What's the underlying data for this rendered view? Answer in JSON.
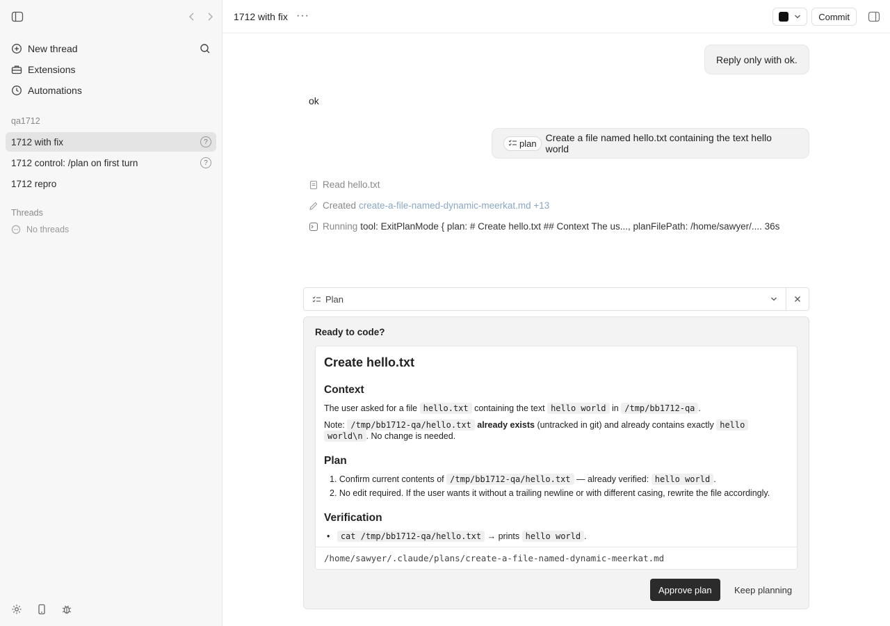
{
  "sidebar": {
    "new_thread": "New thread",
    "extensions": "Extensions",
    "automations": "Automations",
    "project": "qa1712",
    "project_threads": [
      {
        "label": "1712 with fix",
        "active": true,
        "help": "?"
      },
      {
        "label": "1712 control: /plan on first turn",
        "active": false,
        "help": "?"
      },
      {
        "label": "1712 repro",
        "active": false
      }
    ],
    "threads_header": "Threads",
    "no_threads": "No threads"
  },
  "topbar": {
    "title": "1712 with fix",
    "more": "···",
    "commit": "Commit"
  },
  "conversation": {
    "user_msg_1": "Reply only with ok.",
    "assistant_msg_1": "ok",
    "user_msg_2_chip": "plan",
    "user_msg_2": "Create a file named hello.txt containing the text hello world",
    "activity": {
      "read": "Read hello.txt",
      "created_prefix": "Created",
      "created_file": "create-a-file-named-dynamic-meerkat.md +13",
      "running_prefix": "Running",
      "running_text": "tool: ExitPlanMode { plan: # Create hello.txt ## Context The us..., planFilePath: /home/sawyer/.... 36s"
    }
  },
  "plan_panel": {
    "header": "Plan",
    "ready": "Ready to code?",
    "doc": {
      "title": "Create hello.txt",
      "context_h": "Context",
      "ctx_1a": "The user asked for a file",
      "ctx_1_code1": "hello.txt",
      "ctx_1b": "containing the text",
      "ctx_1_code2": "hello world",
      "ctx_1c": "in",
      "ctx_1_code3": "/tmp/bb1712-qa",
      "ctx_1d": ".",
      "note_a": "Note:",
      "note_code1": "/tmp/bb1712-qa/hello.txt",
      "note_bold": "already exists",
      "note_b": "(untracked in git) and already contains exactly",
      "note_code2a": "hello",
      "note_code2b": "world\\n",
      "note_c": ". No change is needed.",
      "plan_h": "Plan",
      "step1_a": "1. Confirm current contents of",
      "step1_code1": "/tmp/bb1712-qa/hello.txt",
      "step1_b": "— already verified:",
      "step1_code2": "hello world",
      "step1_c": ".",
      "step2": "2. No edit required. If the user wants it without a trailing newline or with different casing, rewrite the file accordingly.",
      "verif_h": "Verification",
      "verif_code1": "cat /tmp/bb1712-qa/hello.txt",
      "verif_b": "→ prints",
      "verif_code2": "hello world",
      "verif_c": ".",
      "path": "/home/sawyer/.claude/plans/create-a-file-named-dynamic-meerkat.md"
    },
    "approve": "Approve plan",
    "keep": "Keep planning"
  }
}
